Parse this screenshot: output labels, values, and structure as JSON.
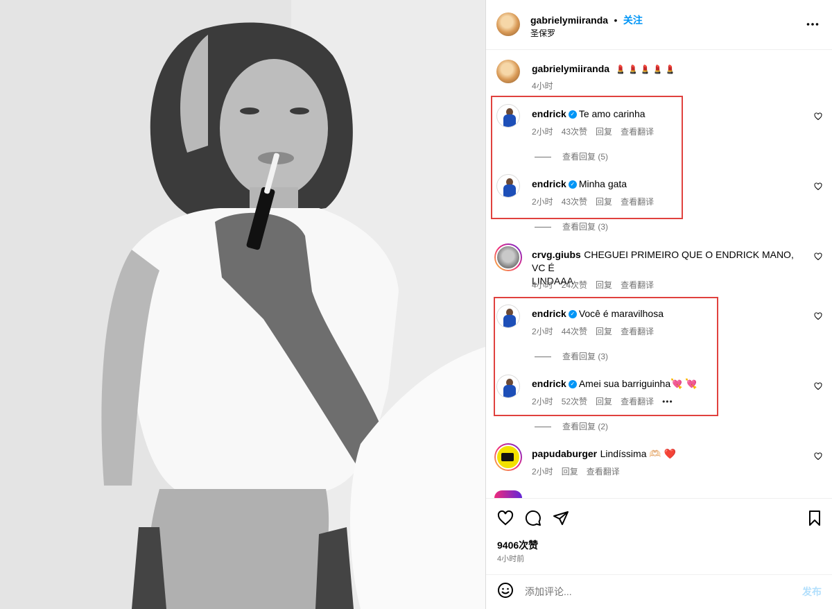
{
  "post": {
    "author": "gabrielymiiranda",
    "follow_label": "关注",
    "location": "圣保罗",
    "more_icon": "more-horizontal-icon"
  },
  "caption": {
    "username": "gabrielymiiranda",
    "text": "💄💄💄💄💄",
    "time": "4小时"
  },
  "comments": [
    {
      "username": "endrick",
      "verified": true,
      "text": "Te amo carinha",
      "time": "2小时",
      "likes": "43次赞",
      "reply": "回复",
      "translate": "查看翻译",
      "view_replies": "查看回复 (5)"
    },
    {
      "username": "endrick",
      "verified": true,
      "text": "Minha gata",
      "time": "2小时",
      "likes": "43次赞",
      "reply": "回复",
      "translate": "查看翻译",
      "view_replies": "查看回复 (3)"
    },
    {
      "username": "crvg.giubs",
      "verified": false,
      "text": "CHEGUEI PRIMEIRO QUE O ENDRICK MANO, VC É",
      "text2": "LINDAAA",
      "time": "4小时",
      "likes": "24次赞",
      "reply": "回复",
      "translate": "查看翻译"
    },
    {
      "username": "endrick",
      "verified": true,
      "text": "Você é maravilhosa",
      "time": "2小时",
      "likes": "44次赞",
      "reply": "回复",
      "translate": "查看翻译",
      "view_replies": "查看回复 (3)"
    },
    {
      "username": "endrick",
      "verified": true,
      "text": "Amei sua barriguinha💘 💘",
      "time": "2小时",
      "likes": "52次赞",
      "reply": "回复",
      "translate": "查看翻译",
      "more": "•••",
      "view_replies": "查看回复 (2)"
    },
    {
      "username": "papudaburger",
      "verified": false,
      "text": "Lindíssima 🫶🏻 ❤️",
      "time": "2小时",
      "reply": "回复",
      "translate": "查看翻译"
    }
  ],
  "footer": {
    "likes": "9406次赞",
    "time": "4小时前",
    "comment_placeholder": "添加评论...",
    "post_label": "发布"
  },
  "colors": {
    "accent": "#0095f6",
    "highlight_box": "#e0413e",
    "muted": "#737373"
  }
}
